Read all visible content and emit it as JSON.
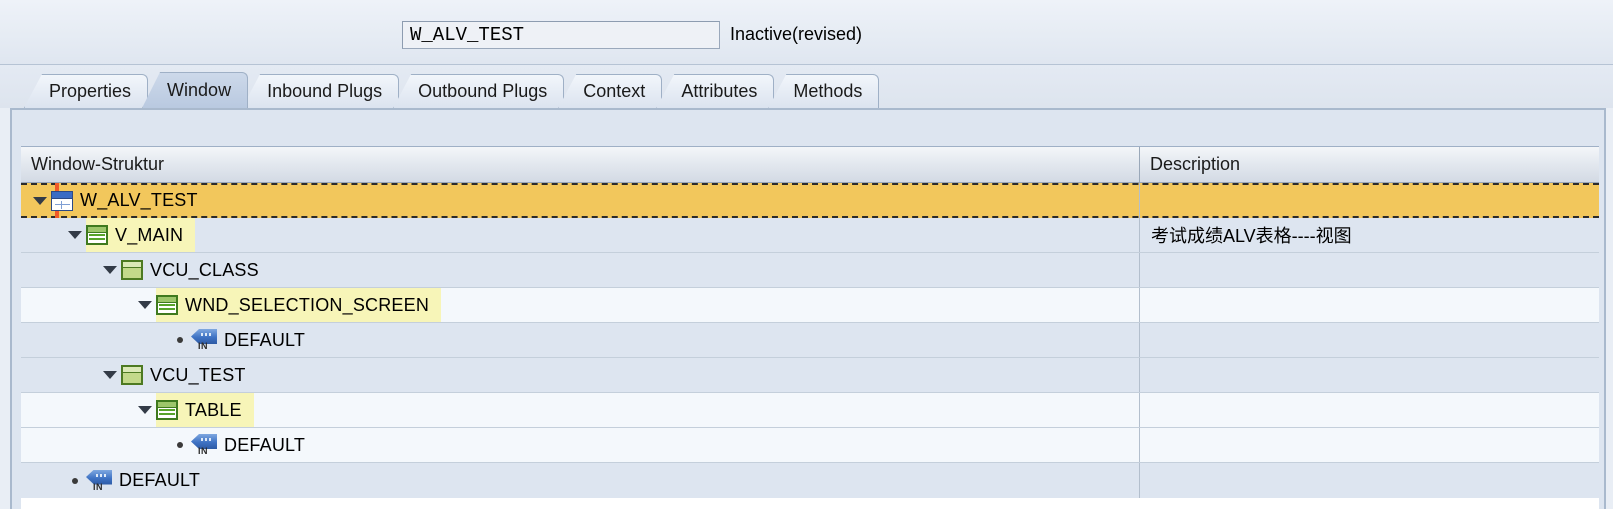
{
  "header": {
    "object_name": "W_ALV_TEST",
    "status": "Inactive(revised)"
  },
  "tabs": [
    {
      "label": "Properties",
      "active": false
    },
    {
      "label": "Window",
      "active": true
    },
    {
      "label": "Inbound Plugs",
      "active": false
    },
    {
      "label": "Outbound Plugs",
      "active": false
    },
    {
      "label": "Context",
      "active": false
    },
    {
      "label": "Attributes",
      "active": false
    },
    {
      "label": "Methods",
      "active": false
    }
  ],
  "grid": {
    "columns": [
      {
        "key": "structure",
        "label": "Window-Struktur"
      },
      {
        "key": "description",
        "label": "Description"
      }
    ],
    "rows": [
      {
        "label": "W_ALV_TEST",
        "description": "",
        "depth": 0,
        "icon": "window-icon",
        "expander": "expanded",
        "selected": true,
        "row_bg": "amber",
        "highlight": true
      },
      {
        "label": "V_MAIN",
        "description": "考试成绩ALV表格----视图",
        "depth": 1,
        "icon": "view-icon",
        "expander": "expanded",
        "selected": false,
        "row_bg": "blue",
        "highlight": true
      },
      {
        "label": "VCU_CLASS",
        "description": "",
        "depth": 2,
        "icon": "container-icon",
        "expander": "expanded",
        "selected": false,
        "row_bg": "blue",
        "highlight": false
      },
      {
        "label": "WND_SELECTION_SCREEN",
        "description": "",
        "depth": 3,
        "icon": "view-icon",
        "expander": "expanded",
        "selected": false,
        "row_bg": "white",
        "highlight": true
      },
      {
        "label": "DEFAULT",
        "description": "",
        "depth": 4,
        "icon": "inbound-plug-icon",
        "expander": "leaf",
        "selected": false,
        "row_bg": "blue",
        "highlight": false
      },
      {
        "label": "VCU_TEST",
        "description": "",
        "depth": 2,
        "icon": "container-icon",
        "expander": "expanded",
        "selected": false,
        "row_bg": "blue",
        "highlight": false
      },
      {
        "label": "TABLE",
        "description": "",
        "depth": 3,
        "icon": "view-icon",
        "expander": "expanded",
        "selected": false,
        "row_bg": "white",
        "highlight": true
      },
      {
        "label": "DEFAULT",
        "description": "",
        "depth": 4,
        "icon": "inbound-plug-icon",
        "expander": "leaf",
        "selected": false,
        "row_bg": "white",
        "highlight": false
      },
      {
        "label": "DEFAULT",
        "description": "",
        "depth": 1,
        "icon": "inbound-plug-icon",
        "expander": "leaf",
        "selected": false,
        "row_bg": "blue",
        "highlight": false
      }
    ]
  },
  "colors": {
    "selected_row": "#f2c75c",
    "highlight_row": "#f7f5b8",
    "alt_row_blue": "#dde5f0",
    "alt_row_white": "#f4f8fc",
    "selection_marker": "#f05a28",
    "active_tab": "#c3d2e6"
  }
}
